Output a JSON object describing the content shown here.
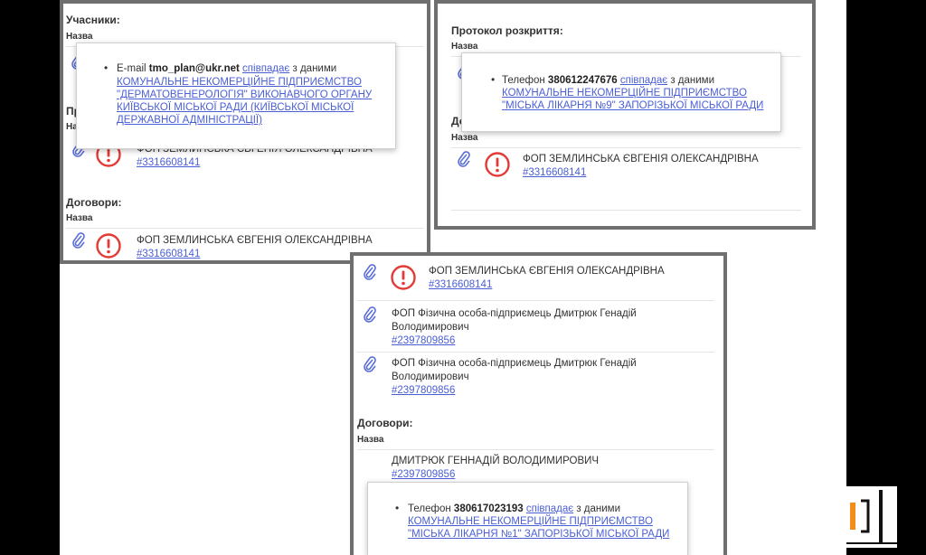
{
  "colors": {
    "link": "#4a5ed6",
    "alert": "#e53935",
    "frame": "#6f6f6f",
    "clip": "#5a6fd6"
  },
  "icons": {
    "attachment": "paperclip-icon",
    "alert": "exclamation-circle-icon"
  },
  "panel_a": {
    "participants_title": "Учасники:",
    "column_header": "Назва",
    "partial_title": "Пр",
    "partial_header": "На",
    "rows": [
      {
        "name": "ФОП ЗЕМЛИНСЬКА ЄВГЕНІЯ ОЛЕКСАНДРІВНА",
        "code": "#3316608141"
      }
    ],
    "contracts_title": "Договори:",
    "contracts_header": "Назва",
    "contracts_rows": [
      {
        "name": "ФОП ЗЕМЛИНСЬКА ЄВГЕНІЯ ОЛЕКСАНДРІВНА",
        "code": "#3316608141"
      }
    ],
    "tooltip": {
      "label": "E-mail",
      "value": "tmo_plan@ukr.net",
      "match_word": "співпадає",
      "suffix": "з даними",
      "org_lines": [
        "Комунальне некомерційне підприємство",
        "\"Дерматовенерологія\" виконавчого органу",
        "Київської міської ради (Київської міської",
        "державної адміністрації)"
      ]
    }
  },
  "panel_b": {
    "title": "Протокол розкриття:",
    "column_header": "Назва",
    "partial_title": "До",
    "second_header": "Назва",
    "rows": [
      {
        "name": "ФОП ЗЕМЛИНСЬКА ЄВГЕНІЯ ОЛЕКСАНДРІВНА",
        "code": "#3316608141"
      }
    ],
    "tooltip": {
      "label": "Телефон",
      "value": "380612247676",
      "match_word": "співпадає",
      "suffix": "з даними",
      "org_lines": [
        "Комунальне некомерційне підприємство",
        "\"Міська лікарня №9\" Запорізької міської ради"
      ]
    }
  },
  "panel_c": {
    "rows": [
      {
        "name": "ФОП ЗЕМЛИНСЬКА ЄВГЕНІЯ ОЛЕКСАНДРІВНА",
        "code": "#3316608141"
      },
      {
        "name1": "ФОП Фізична особа-підприємець Дмитрюк Генадій",
        "name2": "Володимирович",
        "code": "#2397809856"
      },
      {
        "name1": "ФОП Фізична особа-підприємець Дмитрюк Генадій",
        "name2": "Володимирович",
        "code": "#2397809856"
      }
    ],
    "contracts_title": "Договори:",
    "contracts_header": "Назва",
    "contract_row": {
      "name": "ДМИТРЮК ГЕННАДІЙ ВОЛОДИМИРОВИЧ",
      "code": "#2397809856"
    },
    "tooltip": {
      "label": "Телефон",
      "value": "380617023193",
      "match_word": "співпадає",
      "suffix": "з даними",
      "org_lines": [
        "Комунальне некомерційне підприємство",
        "\"Міська лікарня №1\" Запорізької міської ради"
      ]
    }
  }
}
